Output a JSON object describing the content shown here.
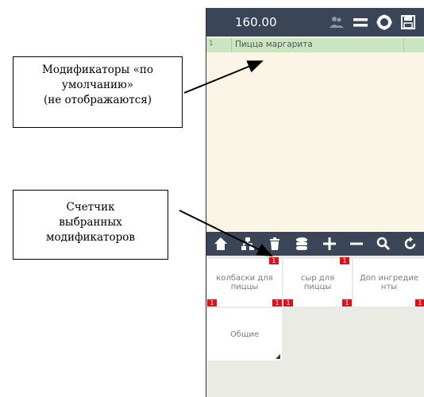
{
  "callouts": {
    "defaults_line1": "Модификаторы «по",
    "defaults_line2": "умолчанию»",
    "defaults_line3": "(не отображаются)",
    "counter_line1": "Счетчик",
    "counter_line2": "выбранных",
    "counter_line3": "модификаторов"
  },
  "topbar": {
    "total": "160.00",
    "icons": [
      "users-icon",
      "menu-icon",
      "settings-icon",
      "save-icon"
    ]
  },
  "order": {
    "rows": [
      {
        "index": "1",
        "name": "Пицца маргарита"
      }
    ],
    "selected_color": "#c9e6c1"
  },
  "toolbar": {
    "icons": [
      "home-icon",
      "network-icon",
      "trash-icon",
      "database-icon",
      "plus-icon",
      "minus-icon",
      "search-icon",
      "refresh-icon"
    ]
  },
  "modifiers": {
    "tiles": [
      {
        "line1": "колбаски для",
        "line2": "пиццы",
        "top_badge": "1",
        "left_badge": "1",
        "right_badge": "1"
      },
      {
        "line1": "сыр для",
        "line2": "пиццы",
        "top_badge": "1",
        "left_badge": "1",
        "right_badge": "1"
      },
      {
        "line1": "Доп ингредие",
        "line2": "нты",
        "right_badge": "1"
      }
    ],
    "group": {
      "label": "Общие"
    }
  },
  "colors": {
    "header": "#3a4658",
    "order_bg": "#fbf5e6",
    "badge": "#e0101a",
    "grid_bg": "#ebebe6"
  }
}
